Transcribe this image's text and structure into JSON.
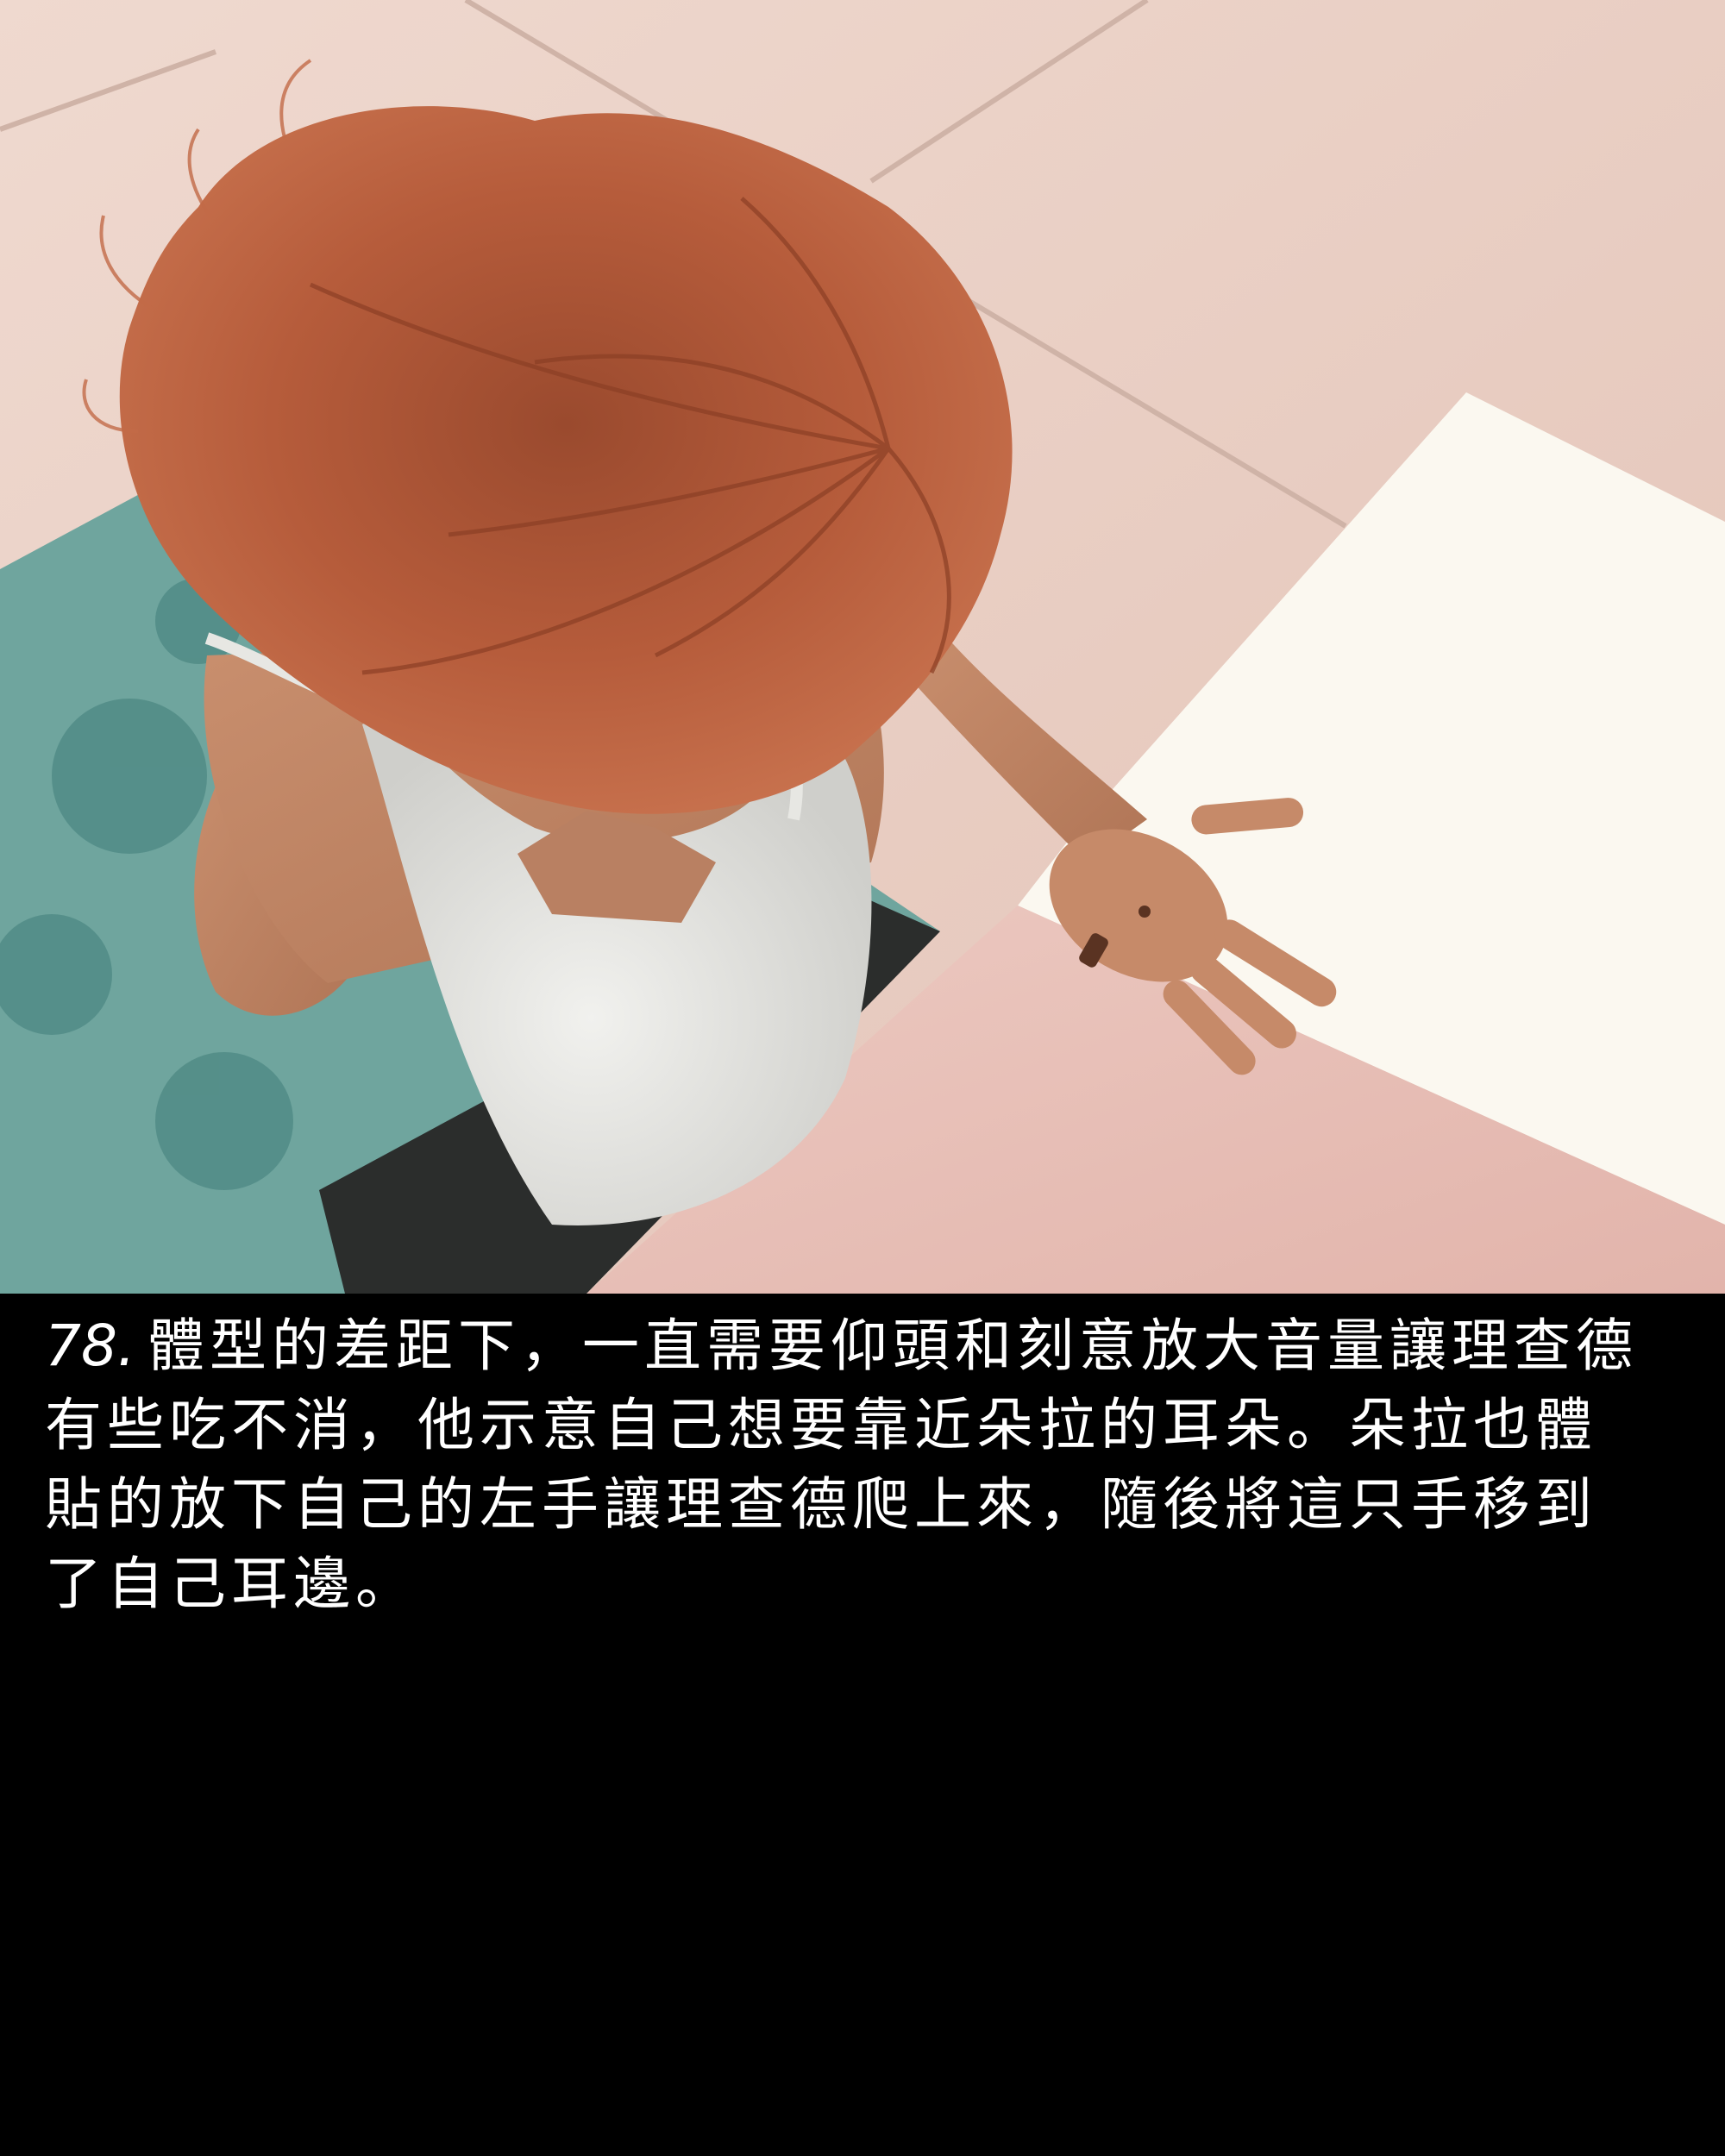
{
  "panel": {
    "background": "#000000",
    "scene_description_colors": {
      "floor": "#ecd6cc",
      "hair": "#b35a3a",
      "top": "#ececea",
      "mat": "#6fa59e",
      "paper_white": "#fbf8f0",
      "paper_pink": "#e6bfb8"
    }
  },
  "caption": {
    "number": "78.",
    "lines": [
      "體型的差距下，一直需要仰頭和刻意放大音量讓理查德",
      "有些吃不消，他示意自己想要靠近朵拉的耳朵。朵拉也體",
      "貼的放下自己的左手讓理查德爬上來，隨後將這只手移到",
      "了自己耳邊。"
    ]
  }
}
